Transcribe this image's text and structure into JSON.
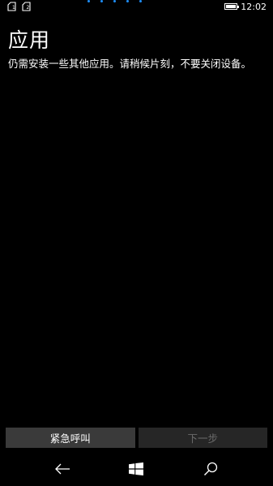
{
  "status_bar": {
    "icons": [
      "sim-1-icon",
      "sim-2-icon"
    ],
    "battery_level": 1.0,
    "time": "12:02",
    "progress_color": "#1E90FF"
  },
  "page": {
    "title": "应用",
    "description": "仍需安装一些其他应用。请稍候片刻，不要关闭设备。"
  },
  "actions": {
    "emergency_call": "紧急呼叫",
    "next": "下一步"
  },
  "navbar": {
    "icons": [
      "back-arrow-icon",
      "windows-start-icon",
      "search-icon"
    ]
  }
}
